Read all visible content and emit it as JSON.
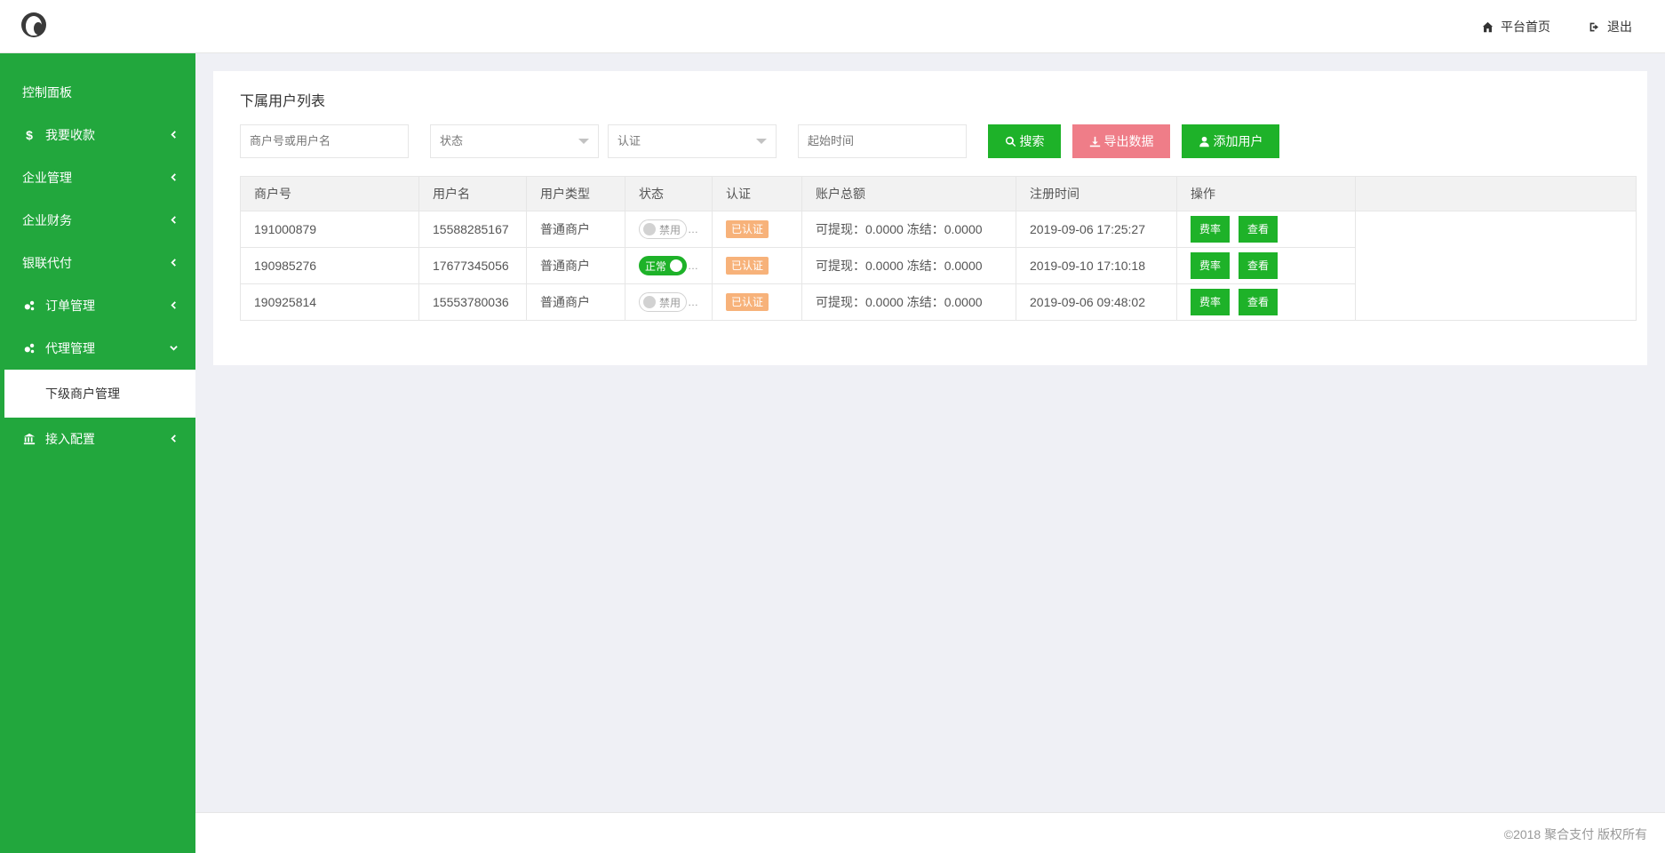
{
  "header": {
    "home_label": "平台首页",
    "logout_label": "退出",
    "icons": [
      "user-avatar-logo",
      "home-icon",
      "sign-out-icon"
    ]
  },
  "sidebar": {
    "items": [
      {
        "label": "控制面板",
        "icon": "",
        "chevron": false
      },
      {
        "label": "我要收款",
        "icon": "dollar-icon",
        "chevron": "left"
      },
      {
        "label": "企业管理",
        "icon": "",
        "chevron": "left"
      },
      {
        "label": "企业财务",
        "icon": "",
        "chevron": "left"
      },
      {
        "label": "银联代付",
        "icon": "",
        "chevron": "left"
      },
      {
        "label": "订单管理",
        "icon": "cogs-icon",
        "chevron": "left"
      },
      {
        "label": "代理管理",
        "icon": "cogs-icon",
        "chevron": "down"
      },
      {
        "label": "接入配置",
        "icon": "bank-icon",
        "chevron": "left"
      }
    ],
    "sub_item": {
      "label": "下级商户管理",
      "active": true
    }
  },
  "panel": {
    "title": "下属用户列表",
    "search_placeholder": "商户号或用户名",
    "status_select": "状态",
    "auth_select": "认证",
    "start_time_placeholder": "起始时间",
    "search_btn": "搜索",
    "export_btn": "导出数据",
    "add_btn": "添加用户"
  },
  "table": {
    "headers": [
      "商户号",
      "用户名",
      "用户类型",
      "状态",
      "认证",
      "账户总额",
      "注册时间",
      "操作"
    ],
    "rows": [
      {
        "id": "191000879",
        "username": "15588285167",
        "type": "普通商户",
        "status": "禁用",
        "status_on": false,
        "auth": "已认证",
        "balance": "可提现：0.0000 冻结：0.0000",
        "time": "2019-09-06 17:25:27",
        "rate": "费率",
        "view": "查看"
      },
      {
        "id": "190985276",
        "username": "17677345056",
        "type": "普通商户",
        "status": "正常",
        "status_on": true,
        "auth": "已认证",
        "balance": "可提现：0.0000 冻结：0.0000",
        "time": "2019-09-10 17:10:18",
        "rate": "费率",
        "view": "查看"
      },
      {
        "id": "190925814",
        "username": "15553780036",
        "type": "普通商户",
        "status": "禁用",
        "status_on": false,
        "auth": "已认证",
        "balance": "可提现：0.0000 冻结：0.0000",
        "time": "2019-09-06 09:48:02",
        "rate": "费率",
        "view": "查看"
      }
    ]
  },
  "footer": {
    "copyright": "©2018 聚合支付 版权所有"
  },
  "colors": {
    "sidebar": "#22a73d",
    "primary_btn": "#1eb229",
    "export_btn": "#ef7d88",
    "badge": "#f7b27a",
    "bg": "#eff0f5"
  }
}
